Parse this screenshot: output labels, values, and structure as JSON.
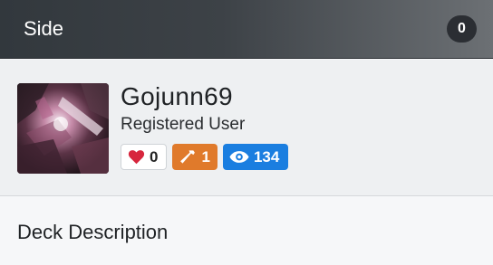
{
  "header": {
    "title": "Side",
    "count": "0"
  },
  "user": {
    "avatar_icon": "avatar-image",
    "name": "Gojunn69",
    "role": "Registered User",
    "stats": {
      "likes": "0",
      "forks": "1",
      "views": "134"
    }
  },
  "section": {
    "title": "Deck Description"
  },
  "colors": {
    "header_start": "#32383d",
    "header_end": "#6c7074",
    "likes_icon": "#d7263d",
    "forks_badge": "#e07a2b",
    "views_badge": "#1a7ee0"
  }
}
